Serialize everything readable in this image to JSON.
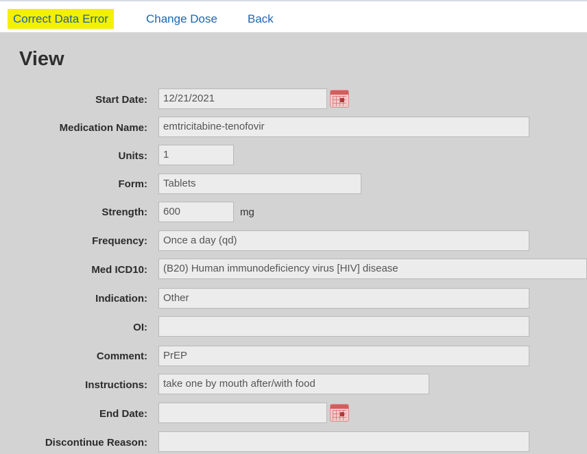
{
  "toolbar": {
    "correct_data_error": "Correct Data Error",
    "change_dose": "Change Dose",
    "back": "Back"
  },
  "page_title": "View",
  "fields": {
    "start_date": {
      "label": "Start Date:",
      "value": "12/21/2021"
    },
    "medication_name": {
      "label": "Medication Name:",
      "value": "emtricitabine-tenofovir"
    },
    "units": {
      "label": "Units:",
      "value": "1"
    },
    "form": {
      "label": "Form:",
      "value": "Tablets"
    },
    "strength": {
      "label": "Strength:",
      "value": "600",
      "unit": "mg"
    },
    "frequency": {
      "label": "Frequency:",
      "value": "Once a day (qd)"
    },
    "med_icd10": {
      "label": "Med ICD10:",
      "value": "(B20) Human immunodeficiency virus [HIV] disease"
    },
    "indication": {
      "label": "Indication:",
      "value": "Other"
    },
    "oi": {
      "label": "OI:",
      "value": ""
    },
    "comment": {
      "label": "Comment:",
      "value": "PrEP"
    },
    "instructions": {
      "label": "Instructions:",
      "value": "take one by mouth after/with food"
    },
    "end_date": {
      "label": "End Date:",
      "value": ""
    },
    "discontinue_reason": {
      "label": "Discontinue Reason:",
      "value": ""
    }
  },
  "icons": {
    "calendar": "calendar-icon"
  },
  "colors": {
    "highlight": "#f3f000",
    "link": "#1a66b5",
    "panel": "#d3d3d3"
  }
}
